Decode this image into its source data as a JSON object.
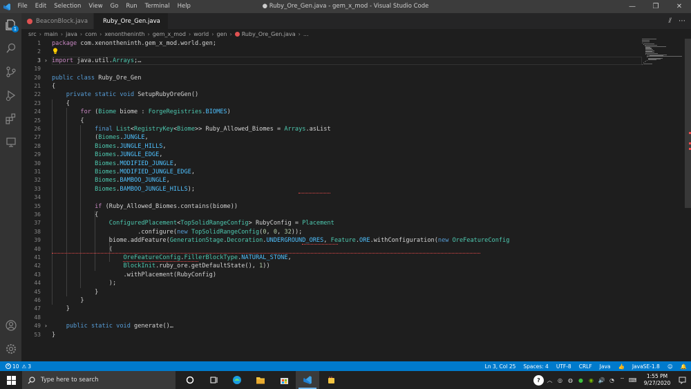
{
  "titlebar": {
    "menu": [
      "File",
      "Edit",
      "Selection",
      "View",
      "Go",
      "Run",
      "Terminal",
      "Help"
    ],
    "title": "● Ruby_Ore_Gen.java - gem_x_mod - Visual Studio Code",
    "controls": [
      "—",
      "❐",
      "✕"
    ]
  },
  "activity": {
    "items": [
      "explorer-icon",
      "search-icon",
      "source-control-icon",
      "run-debug-icon",
      "extensions-icon",
      "remote-icon"
    ],
    "badge": "1",
    "bottom": [
      "account-icon",
      "settings-gear-icon"
    ]
  },
  "tabs": [
    {
      "label": "BeaconBlock.java",
      "active": false,
      "dirty": false
    },
    {
      "label": "Ruby_Ore_Gen.java",
      "active": true,
      "dirty": true
    }
  ],
  "tab_actions": [
    "⫽",
    "⋯"
  ],
  "breadcrumb": [
    "src",
    "main",
    "java",
    "com",
    "xenontheninth",
    "gem_x_mod",
    "world",
    "gen",
    "Ruby_Ore_Gen.java",
    "..."
  ],
  "editor": {
    "lines": [
      {
        "n": "1",
        "text": "package com.xenontheninth.gem_x_mod.world.gen;"
      },
      {
        "n": "2",
        "text": ""
      },
      {
        "n": "3",
        "text": "import java.util.Arrays;…",
        "fold": "›",
        "current": true
      },
      {
        "n": "19",
        "text": ""
      },
      {
        "n": "20",
        "text": "public class Ruby_Ore_Gen"
      },
      {
        "n": "21",
        "text": "{"
      },
      {
        "n": "22",
        "text": "    private static void SetupRubyOreGen()"
      },
      {
        "n": "23",
        "text": "    {"
      },
      {
        "n": "24",
        "text": "        for (Biome biome : ForgeRegistries.BIOMES)"
      },
      {
        "n": "25",
        "text": "        {"
      },
      {
        "n": "26",
        "text": "            final List<RegistryKey<Biome>> Ruby_Allowed_Biomes = Arrays.asList"
      },
      {
        "n": "27",
        "text": "            (Biomes.JUNGLE,"
      },
      {
        "n": "28",
        "text": "            Biomes.JUNGLE_HILLS,"
      },
      {
        "n": "29",
        "text": "            Biomes.JUNGLE_EDGE,"
      },
      {
        "n": "30",
        "text": "            Biomes.MODIFIED_JUNGLE,"
      },
      {
        "n": "31",
        "text": "            Biomes.MODIFIED_JUNGLE_EDGE,"
      },
      {
        "n": "32",
        "text": "            Biomes.BAMBOO_JUNGLE,"
      },
      {
        "n": "33",
        "text": "            Biomes.BAMBOO_JUNGLE_HILLS);"
      },
      {
        "n": "34",
        "text": ""
      },
      {
        "n": "35",
        "text": "            if (Ruby_Allowed_Biomes.contains(biome))"
      },
      {
        "n": "36",
        "text": "            {"
      },
      {
        "n": "37",
        "text": "                ConfiguredPlacement<TopSolidRangeConfig> RubyConfig = Placement"
      },
      {
        "n": "38",
        "text": "                        .configure(new TopSolidRangeConfig(0, 0, 32));"
      },
      {
        "n": "39",
        "text": "                biome.addFeature(GenerationStage.Decoration.UNDERGROUND_ORES, Feature.ORE.withConfiguration(new OreFeatureConfig"
      },
      {
        "n": "40",
        "text": "                ("
      },
      {
        "n": "41",
        "text": "                    OreFeatureConfig.FillerBlockType.NATURAL_STONE,"
      },
      {
        "n": "42",
        "text": "                    BlockInit.ruby_ore.getDefaultState(), 1))"
      },
      {
        "n": "43",
        "text": "                    .withPlacement(RubyConfig)"
      },
      {
        "n": "44",
        "text": "                );"
      },
      {
        "n": "45",
        "text": "            }"
      },
      {
        "n": "46",
        "text": "        }"
      },
      {
        "n": "47",
        "text": "    }"
      },
      {
        "n": "48",
        "text": ""
      },
      {
        "n": "49",
        "text": "    public static void generate()…",
        "fold": "›"
      },
      {
        "n": "53",
        "text": "}"
      }
    ]
  },
  "statusbar": {
    "errors": "10",
    "warnings": "3",
    "position": "Ln 3, Col 25",
    "spaces": "Spaces: 4",
    "encoding": "UTF-8",
    "eol": "CRLF",
    "language": "Java",
    "jdk": "JavaSE-1.8"
  },
  "taskbar": {
    "search_placeholder": "Type here to search",
    "time": "1:55 PM",
    "date": "9/27/2020",
    "apps": [
      "task-view-icon",
      "edge-icon",
      "file-explorer-icon",
      "store-icon",
      "vscode-icon",
      "java-icon"
    ]
  },
  "colors": {
    "accent": "#007acc",
    "editor_bg": "#1e1e1e",
    "keyword": "#569cd6",
    "type": "#4ec9b0",
    "error": "#f14c4c"
  }
}
